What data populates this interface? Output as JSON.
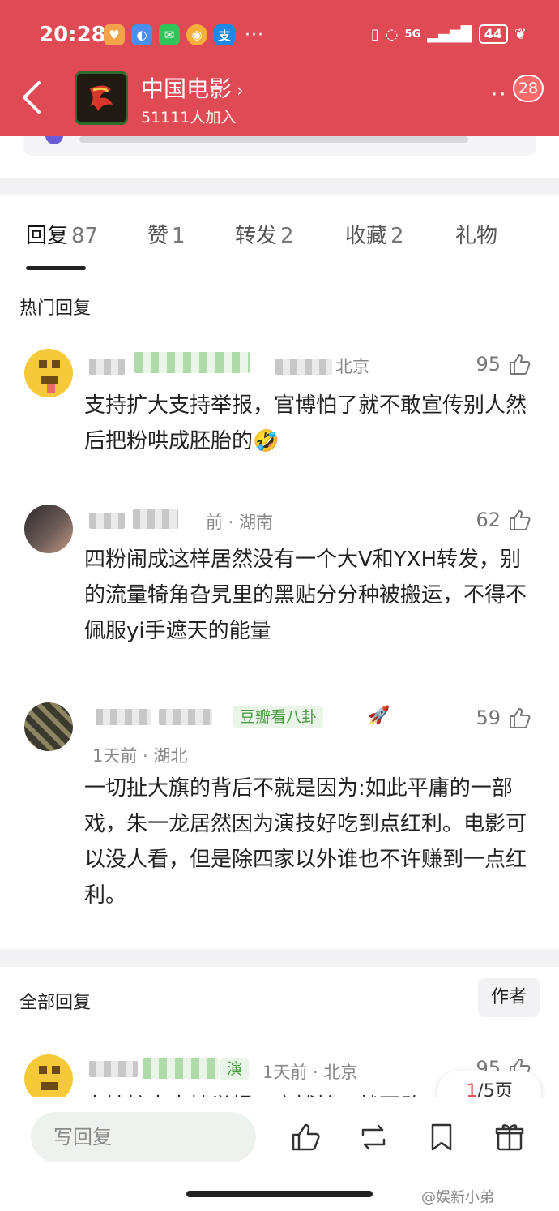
{
  "status_bar": {
    "time": "20:28",
    "battery": "44",
    "network": "5G"
  },
  "header": {
    "title": "中国电影",
    "member_count": "51111人加入",
    "notification_badge": "28"
  },
  "tabs": [
    {
      "label": "回复",
      "count": "87"
    },
    {
      "label": "赞",
      "count": "1"
    },
    {
      "label": "转发",
      "count": "2"
    },
    {
      "label": "收藏",
      "count": "2"
    },
    {
      "label": "礼物",
      "count": ""
    }
  ],
  "hot_section": {
    "title": "热门回复"
  },
  "hot_comments": [
    {
      "meta": "北京",
      "likes": "95",
      "text": "支持扩大支持举报，官博怕了就不敢宣传别人然后把粉哄成胚胎的🤣"
    },
    {
      "meta": "前 · 湖南",
      "likes": "62",
      "text": "四粉闹成这样居然没有一个大V和YXH转发，别的流量犄角旮旯里的黑贴分分种被搬运，不得不佩服yi手遮天的能量"
    },
    {
      "meta": "1天前 · 湖北",
      "likes": "59",
      "tag": "豆瓣看八卦",
      "text": "一切扯大旗的背后不就是因为:如此平庸的一部戏，朱一龙居然因为演技好吃到点红利。电影可以没人看，但是除四家以外谁也不许赚到一点红利。"
    }
  ],
  "all_section": {
    "title": "全部回复",
    "author_filter": "作者"
  },
  "all_comments": [
    {
      "meta": "1天前 · 北京",
      "likes": "95",
      "tag": "演",
      "text": "支持扩大支持举报，官博怕了就不敢"
    }
  ],
  "pagination": {
    "current": "1",
    "total": "/5页"
  },
  "bottom_bar": {
    "reply_placeholder": "写回复"
  },
  "watermark": "@娱新小弟",
  "colors": {
    "header_red": "#e04a55",
    "tag_green": "#4a9b43"
  }
}
